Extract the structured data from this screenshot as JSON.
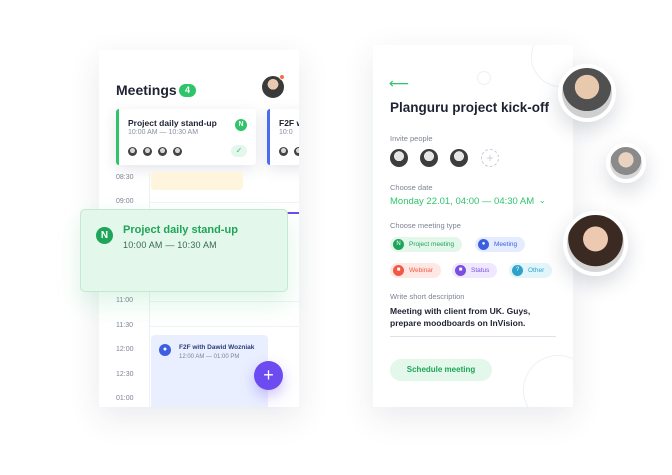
{
  "left_screen": {
    "title": "Meetings",
    "count": "4",
    "cards": [
      {
        "title": "Project daily stand-up",
        "time": "10:00 AM — 10:30 AM",
        "logo": "N",
        "check": "✓"
      },
      {
        "title": "F2F w",
        "time": "10:0"
      }
    ],
    "hours": [
      "08:30",
      "09:00",
      "11:00",
      "11:30",
      "12:00",
      "12:30",
      "01:00"
    ],
    "f2f_event": {
      "title": "F2F with Dawid Wozniak",
      "time": "12:00 AM — 01:00 PM"
    },
    "fab_label": "+"
  },
  "float_event": {
    "logo": "N",
    "title": "Project daily stand-up",
    "time": "10:00 AM — 10:30 AM"
  },
  "right_screen": {
    "back": "⟵",
    "title": "Planguru project kick-off",
    "invite_label": "Invite people",
    "add_symbol": "+",
    "date_label": "Choose date",
    "date_value": "Monday 22.01, 04:00 — 04:30 AM",
    "date_chevron": "⌄",
    "type_label": "Choose meeting type",
    "types": [
      {
        "label": "Project meeting",
        "icon": "N"
      },
      {
        "label": "Meeting",
        "icon": "●"
      },
      {
        "label": "Webinar",
        "icon": "■"
      },
      {
        "label": "Status",
        "icon": "■"
      },
      {
        "label": "Other",
        "icon": "?"
      }
    ],
    "desc_label": "Write short description",
    "desc_value": "Meeting with client from UK. Guys, prepare moodboards on InVision.",
    "schedule_button": "Schedule meeting"
  },
  "colors": {
    "accent_green": "#2fc46a",
    "accent_purple": "#6c4cf0",
    "accent_blue": "#3b5fe0",
    "accent_red": "#ef5a45"
  }
}
